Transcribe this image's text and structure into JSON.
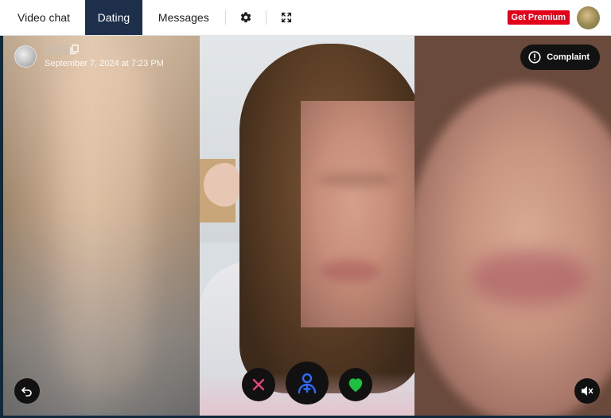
{
  "nav": {
    "tabs": [
      {
        "label": "Video chat",
        "active": false
      },
      {
        "label": "Dating",
        "active": true
      },
      {
        "label": "Messages",
        "active": false
      }
    ],
    "settings_icon": "gear-icon",
    "fullscreen_icon": "fullscreen-icon",
    "premium_label": "Get Premium",
    "premium_color": "#e3001b",
    "accent_color": "#1d2f4b"
  },
  "chat": {
    "timestamp": "September 7, 2024 at 7:23 PM",
    "complaint_label": "Complaint"
  },
  "controls": {
    "back_icon": "undo-arrow-icon",
    "skip_icon": "close-icon",
    "add_icon": "add-user-icon",
    "like_icon": "heart-icon",
    "mute_icon": "speaker-muted-icon",
    "skip_color": "#e0457b",
    "add_color": "#2f6bff",
    "like_color": "#1fbf3f"
  }
}
